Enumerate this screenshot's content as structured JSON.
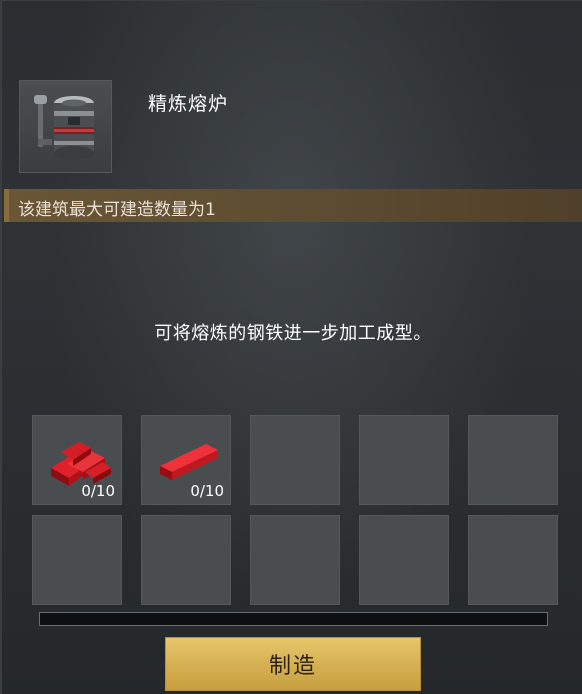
{
  "building": {
    "name": "精炼熔炉",
    "icon": "furnace-icon",
    "limit_text": "该建筑最大可建造数量为1",
    "description": "可将熔炼的钢铁进一步加工成型。"
  },
  "materials": [
    {
      "icon": "steel-ingot-pile-icon",
      "count": "0/10"
    },
    {
      "icon": "steel-bar-icon",
      "count": "0/10"
    }
  ],
  "empty_slots": 8,
  "progress": {
    "value": 0
  },
  "craft_button": {
    "label": "制造"
  },
  "colors": {
    "accent_gold": "#d8b355",
    "limit_bar": "#6a5636",
    "ingot_red": "#c0101a"
  }
}
